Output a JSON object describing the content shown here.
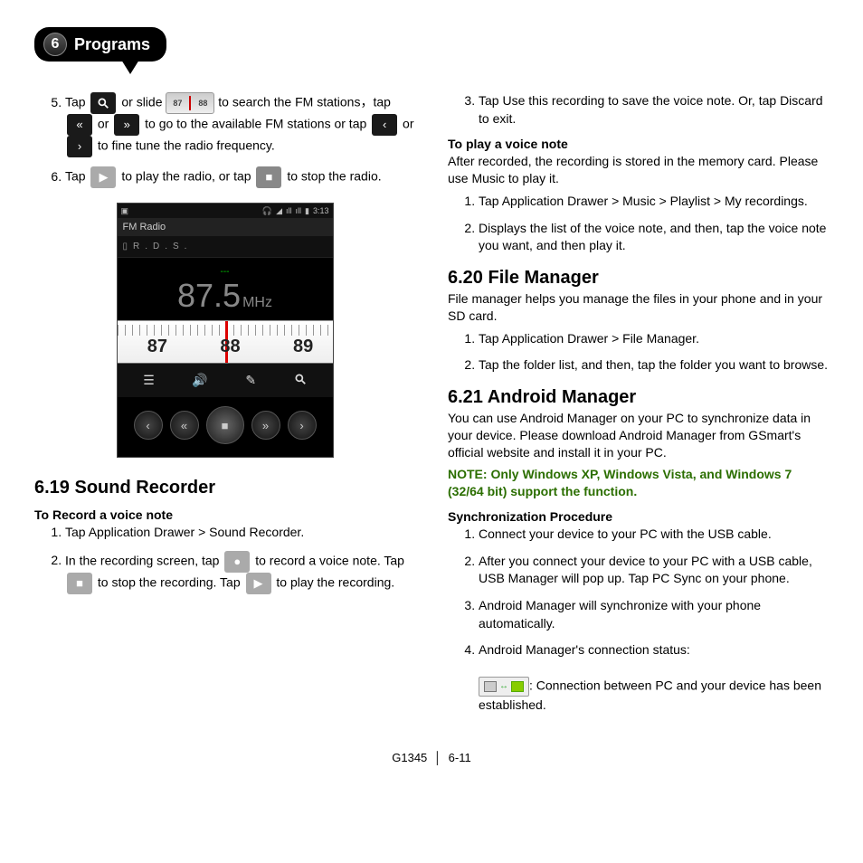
{
  "chapter": {
    "number": "6",
    "title": "Programs"
  },
  "left": {
    "step5_pre": "Tap",
    "step5_or_slide": "or slide",
    "step5_slide_left": "87",
    "step5_slide_right": "88",
    "step5_mid": "to search the FM stations，tap",
    "step5_or": "or",
    "step5_mid2": "to go to the available FM stations or tap",
    "step5_or2": "or",
    "step5_end": "to fine tune the radio frequency.",
    "step6_pre": "Tap",
    "step6_mid": "to play the radio, or tap",
    "step6_end": "to stop the radio.",
    "fm": {
      "status_time": "3:13",
      "title": "FM Radio",
      "rds": "R.D.S.",
      "dots": "---",
      "freq": "87.5",
      "unit": "MHz",
      "dial_87": "87",
      "dial_88": "88",
      "dial_89": "89"
    },
    "sect_619": "6.19 Sound Recorder",
    "sub_record": "To Record a voice note",
    "rec1": "Tap Application Drawer > Sound Recorder.",
    "rec2_pre": "In the recording screen, tap",
    "rec2_mid": "to record a voice note. Tap",
    "rec2_mid2": "to stop the recording. Tap",
    "rec2_end": "to play the recording."
  },
  "right": {
    "step3": "Tap Use this recording to save the voice note. Or, tap Discard to exit.",
    "sub_play": "To play a voice note",
    "play_intro": "After recorded, the recording is stored in the memory card. Please use Music to play it.",
    "play1": "Tap Application Drawer > Music > Playlist > My recordings.",
    "play2": "Displays the list of the voice note, and then, tap the voice note you want, and then play it.",
    "sect_620": "6.20 File Manager",
    "fm_intro": "File manager helps you manage the files in your phone and in your SD card.",
    "fm1": "Tap Application Drawer > File Manager.",
    "fm2": "Tap the folder list, and then, tap the folder you want to browse.",
    "sect_621": "6.21 Android Manager",
    "am_intro": "You can use Android Manager on your PC to synchronize data in your device. Please download Android Manager from GSmart's official website and install it in your PC.",
    "am_note": "NOTE: Only Windows XP, Windows Vista, and Windows 7 (32/64 bit) support the function.",
    "sub_sync": "Synchronization Procedure",
    "sync1": "Connect your device to your PC with the USB cable.",
    "sync2": "After you connect your device to your PC with a USB cable, USB Manager will pop up. Tap PC Sync on your phone.",
    "sync3": "Android Manager will synchronize with your phone automatically.",
    "sync4": "Android Manager's connection status:",
    "conn_text": ": Connection between PC and your device has been established."
  },
  "footer": {
    "model": "G1345",
    "page": "6-11"
  }
}
